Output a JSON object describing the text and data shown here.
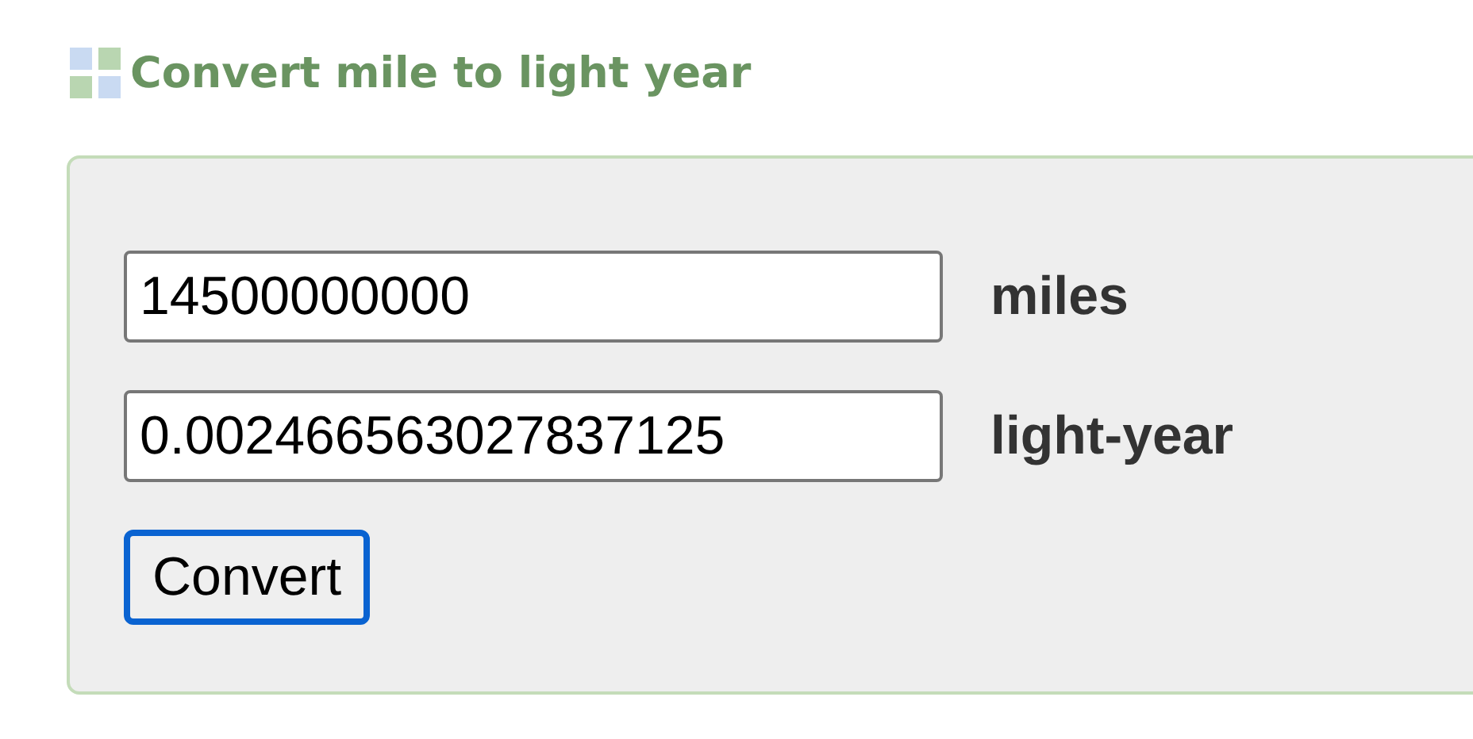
{
  "title": "Convert mile to light year",
  "fields": [
    {
      "value": "14500000000",
      "unit": "miles"
    },
    {
      "value": "0.002466563027837125",
      "unit": "light-year"
    }
  ],
  "button": {
    "label": "Convert",
    "focused": true
  }
}
